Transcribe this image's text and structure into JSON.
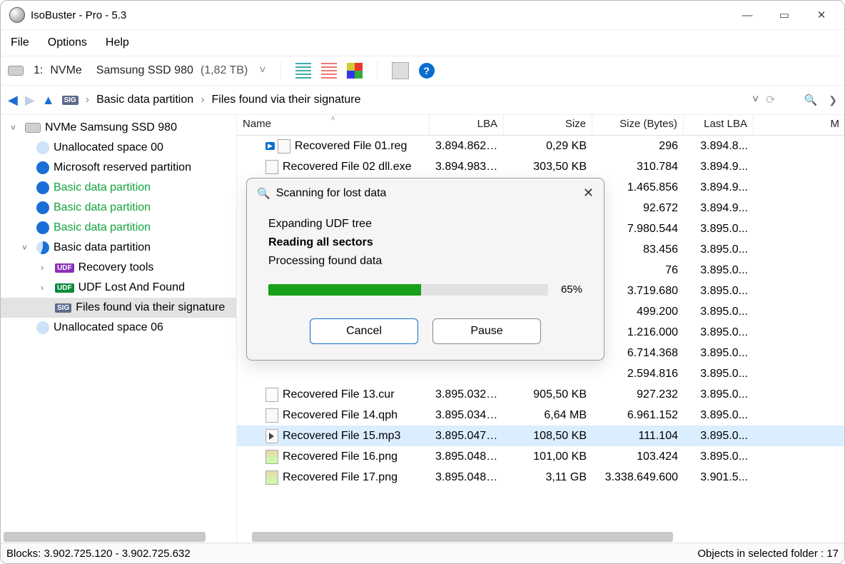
{
  "window": {
    "title": "IsoBuster - Pro - 5.3"
  },
  "menu": {
    "file": "File",
    "options": "Options",
    "help": "Help"
  },
  "toolbar": {
    "device_num": "1:",
    "device_bus": "NVMe",
    "device_model": "Samsung SSD 980",
    "device_size": "(1,82 TB)",
    "help_glyph": "?"
  },
  "breadcrumb": {
    "seg1": "Basic data partition",
    "seg2": "Files found via their signature",
    "sep": "›",
    "chev_down": "˅"
  },
  "tree": {
    "root": "NVMe Samsung SSD 980",
    "items": [
      {
        "label": "Unallocated space 00",
        "cls": "lt"
      },
      {
        "label": "Microsoft reserved partition",
        "cls": "blue"
      },
      {
        "label": "Basic data partition",
        "cls": "blue",
        "green": true
      },
      {
        "label": "Basic data partition",
        "cls": "blue",
        "green": true
      },
      {
        "label": "Basic data partition",
        "cls": "blue",
        "green": true
      },
      {
        "label": "Basic data partition",
        "cls": "half",
        "exp": true
      },
      {
        "label": "Unallocated space 06",
        "cls": "lt"
      }
    ],
    "sub": [
      {
        "badge": "UDF",
        "badgecls": "udf-badge",
        "label": "Recovery tools"
      },
      {
        "badge": "UDF",
        "badgecls": "udf-badge g",
        "label": "UDF Lost And Found"
      },
      {
        "badge": "SIG",
        "badgecls": "sig-badge",
        "label": "Files found via their signature",
        "sel": true
      }
    ]
  },
  "cols": {
    "name": "Name",
    "lba": "LBA",
    "size": "Size",
    "bytes": "Size (Bytes)",
    "last": "Last LBA",
    "m": "M"
  },
  "rows": [
    {
      "n": "Recovered File 01.reg",
      "lba": "3.894.862....",
      "size": "0,29 KB",
      "bytes": "296",
      "last": "3.894.8...",
      "ico": "fico",
      "arrow": true
    },
    {
      "n": "Recovered File 02 dll.exe",
      "lba": "3.894.983....",
      "size": "303,50 KB",
      "bytes": "310.784",
      "last": "3.894.9...",
      "ico": "fico"
    },
    {
      "n": "",
      "lba": "",
      "size": "",
      "bytes": "1.465.856",
      "last": "3.894.9..."
    },
    {
      "n": "",
      "lba": "",
      "size": "",
      "bytes": "92.672",
      "last": "3.894.9..."
    },
    {
      "n": "",
      "lba": "",
      "size": "",
      "bytes": "7.980.544",
      "last": "3.895.0..."
    },
    {
      "n": "",
      "lba": "",
      "size": "",
      "bytes": "83.456",
      "last": "3.895.0..."
    },
    {
      "n": "",
      "lba": "",
      "size": "",
      "bytes": "76",
      "last": "3.895.0..."
    },
    {
      "n": "",
      "lba": "",
      "size": "",
      "bytes": "3.719.680",
      "last": "3.895.0..."
    },
    {
      "n": "",
      "lba": "",
      "size": "",
      "bytes": "499.200",
      "last": "3.895.0..."
    },
    {
      "n": "",
      "lba": "",
      "size": "",
      "bytes": "1.216.000",
      "last": "3.895.0..."
    },
    {
      "n": "",
      "lba": "",
      "size": "",
      "bytes": "6.714.368",
      "last": "3.895.0..."
    },
    {
      "n": "",
      "lba": "",
      "size": "",
      "bytes": "2.594.816",
      "last": "3.895.0..."
    },
    {
      "n": "Recovered File 13.cur",
      "lba": "3.895.032....",
      "size": "905,50 KB",
      "bytes": "927.232",
      "last": "3.895.0...",
      "ico": "fico"
    },
    {
      "n": "Recovered File 14.qph",
      "lba": "3.895.034....",
      "size": "6,64 MB",
      "bytes": "6.961.152",
      "last": "3.895.0...",
      "ico": "fico"
    },
    {
      "n": "Recovered File 15.mp3",
      "lba": "3.895.047....",
      "size": "108,50 KB",
      "bytes": "111.104",
      "last": "3.895.0...",
      "ico": "fico media",
      "sel": true
    },
    {
      "n": "Recovered File 16.png",
      "lba": "3.895.048....",
      "size": "101,00 KB",
      "bytes": "103.424",
      "last": "3.895.0...",
      "ico": "fico img"
    },
    {
      "n": "Recovered File 17.png",
      "lba": "3.895.048....",
      "size": "3,11 GB",
      "bytes": "3.338.649.600",
      "last": "3.901.5...",
      "ico": "fico img"
    }
  ],
  "dialog": {
    "title": "Scanning for lost data",
    "line1": "Expanding UDF tree",
    "line2": "Reading all sectors",
    "line3": "Processing found data",
    "percent": "65%",
    "percent_n": 65,
    "cancel": "Cancel",
    "pause": "Pause"
  },
  "status": {
    "left": "Blocks: 3.902.725.120 - 3.902.725.632",
    "right": "Objects in selected folder : 17"
  }
}
